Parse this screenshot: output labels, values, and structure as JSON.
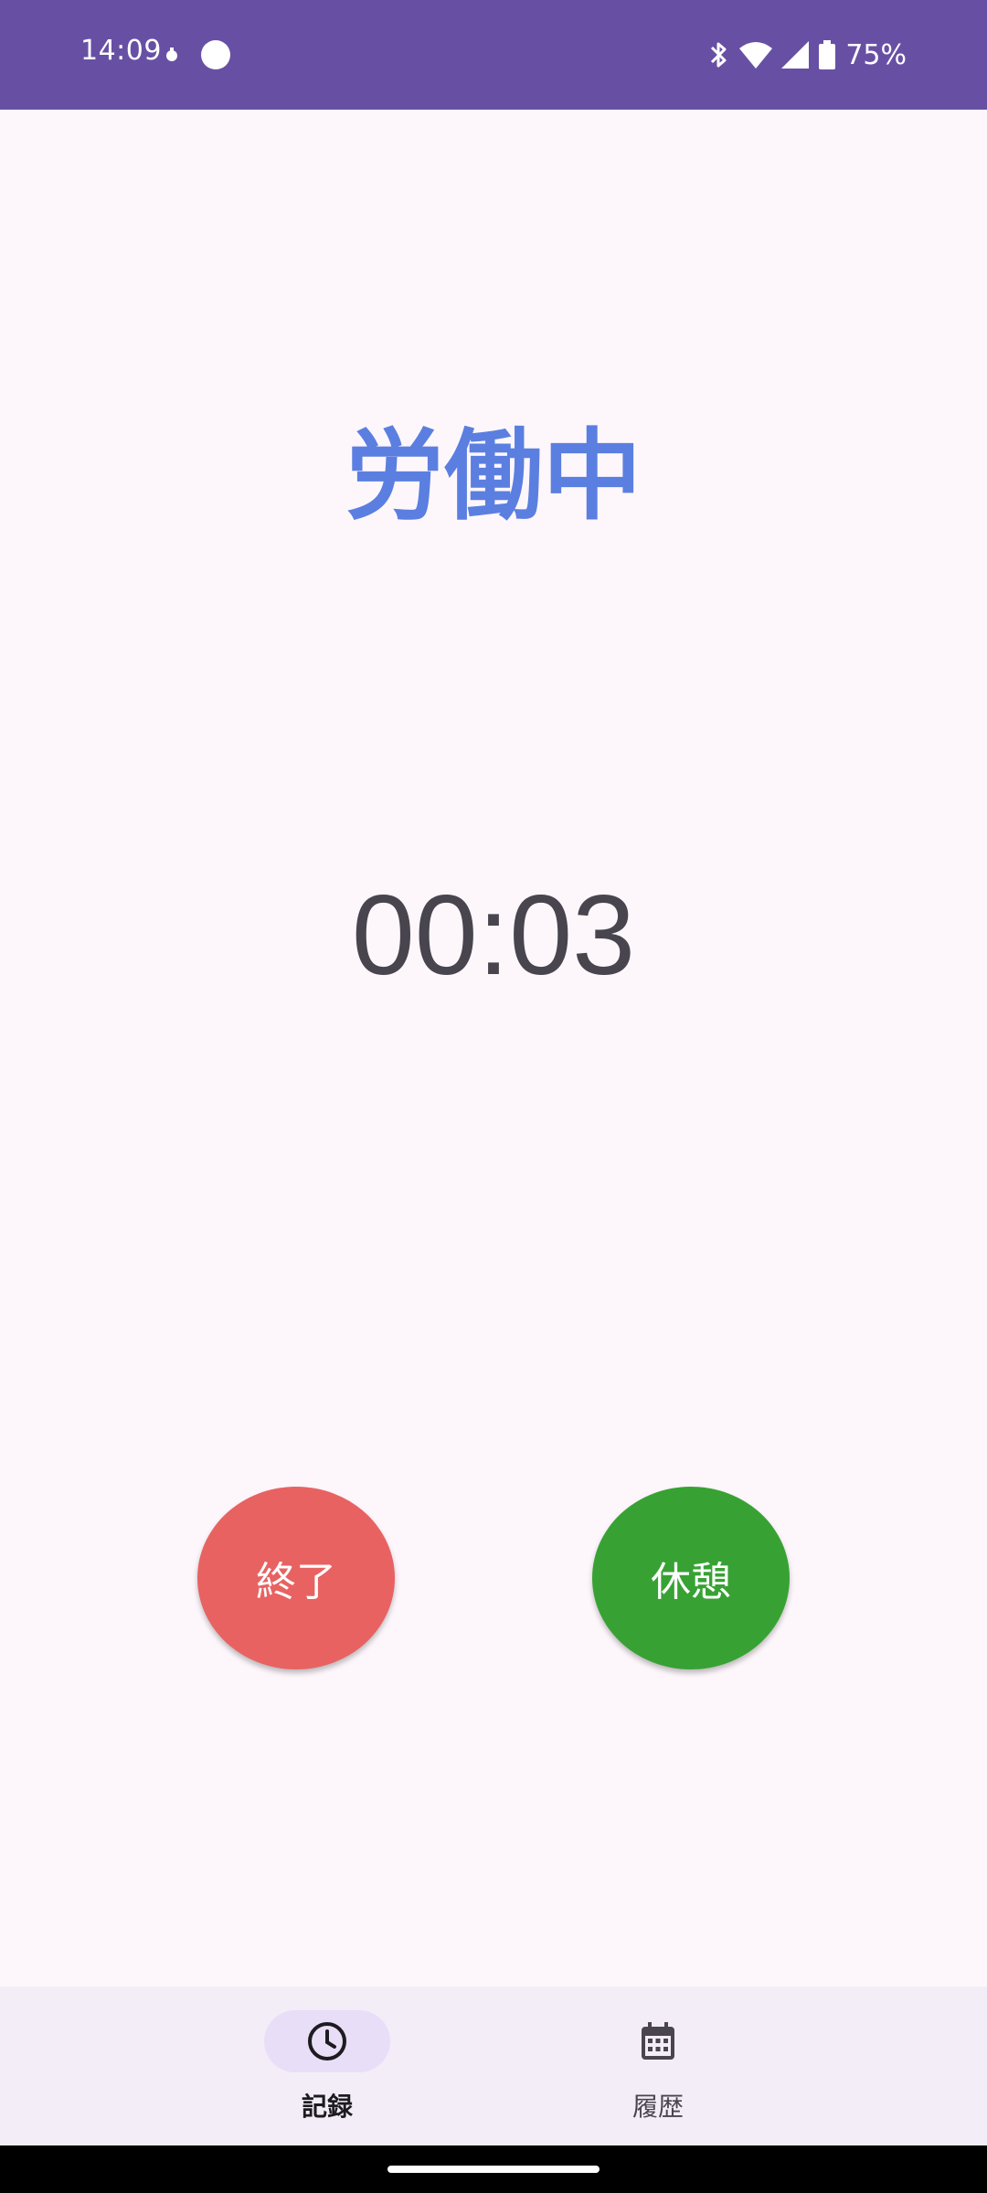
{
  "status_bar": {
    "time": "14:09",
    "battery": "75%",
    "icons": [
      "notification-dot-icon",
      "circle-icon",
      "bluetooth-icon",
      "wifi-icon",
      "signal-icon",
      "battery-icon"
    ]
  },
  "main": {
    "state_title": "労働中",
    "timer": "00:03",
    "end_button": "終了",
    "break_button": "休憩"
  },
  "bottom_nav": {
    "items": [
      {
        "label": "記録",
        "icon": "clock-icon",
        "active": true
      },
      {
        "label": "履歴",
        "icon": "calendar-icon",
        "active": false
      }
    ]
  },
  "colors": {
    "status_bar": "#6750a4",
    "title": "#5b7fe0",
    "end_button": "#e86262",
    "break_button": "#37a233",
    "nav_background": "#f3edf7",
    "nav_active_pill": "#e8def8"
  }
}
